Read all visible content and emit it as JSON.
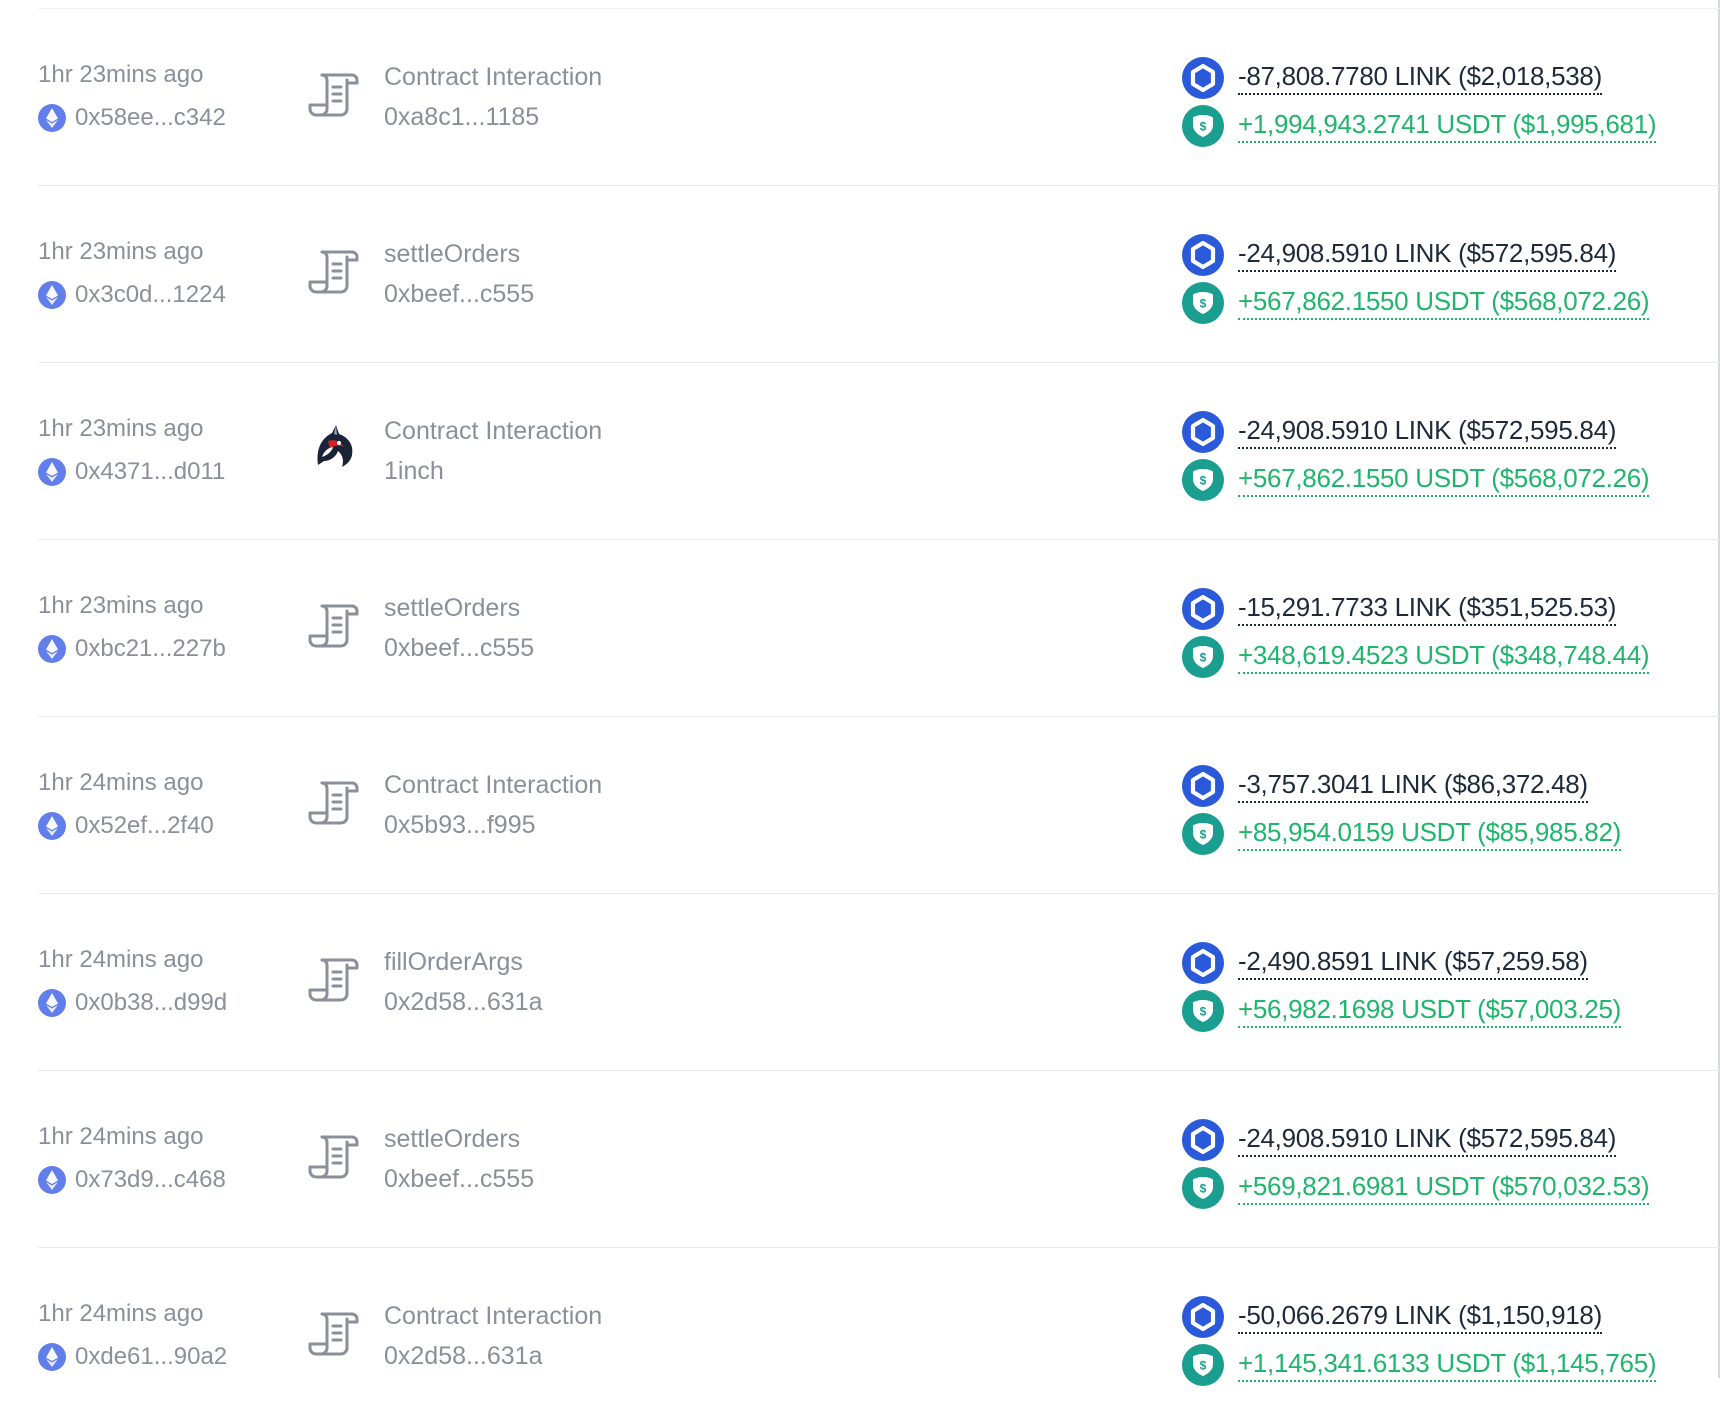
{
  "colors": {
    "muted_text": "#8a8f99",
    "negative_amount": "#1e2a3b",
    "positive_amount": "#1fb56b",
    "link_token": "#2a5ada",
    "usdt_token": "#1a9e8f",
    "eth_icon": "#627eea"
  },
  "icons": {
    "from_chain": "ethereum-icon",
    "method_default": "scroll-contract-icon",
    "method_1inch": "1inch-unicorn-icon",
    "token_out": "chainlink-icon",
    "token_in": "usdt-icon"
  },
  "transactions": [
    {
      "time": "1hr 23mins ago",
      "from": "0x58ee...c342",
      "method": "Contract Interaction",
      "contract": "0xa8c1...1185",
      "method_icon": "scroll",
      "out": "-87,808.7780 LINK ($2,018,538)",
      "in": "+1,994,943.2741 USDT ($1,995,681)"
    },
    {
      "time": "1hr 23mins ago",
      "from": "0x3c0d...1224",
      "method": "settleOrders",
      "contract": "0xbeef...c555",
      "method_icon": "scroll",
      "out": "-24,908.5910 LINK ($572,595.84)",
      "in": "+567,862.1550 USDT ($568,072.26)"
    },
    {
      "time": "1hr 23mins ago",
      "from": "0x4371...d011",
      "method": "Contract Interaction",
      "contract": "1inch",
      "method_icon": "1inch",
      "out": "-24,908.5910 LINK ($572,595.84)",
      "in": "+567,862.1550 USDT ($568,072.26)"
    },
    {
      "time": "1hr 23mins ago",
      "from": "0xbc21...227b",
      "method": "settleOrders",
      "contract": "0xbeef...c555",
      "method_icon": "scroll",
      "out": "-15,291.7733 LINK ($351,525.53)",
      "in": "+348,619.4523 USDT ($348,748.44)"
    },
    {
      "time": "1hr 24mins ago",
      "from": "0x52ef...2f40",
      "method": "Contract Interaction",
      "contract": "0x5b93...f995",
      "method_icon": "scroll",
      "out": "-3,757.3041 LINK ($86,372.48)",
      "in": "+85,954.0159 USDT ($85,985.82)"
    },
    {
      "time": "1hr 24mins ago",
      "from": "0x0b38...d99d",
      "method": "fillOrderArgs",
      "contract": "0x2d58...631a",
      "method_icon": "scroll",
      "out": "-2,490.8591 LINK ($57,259.58)",
      "in": "+56,982.1698 USDT ($57,003.25)"
    },
    {
      "time": "1hr 24mins ago",
      "from": "0x73d9...c468",
      "method": "settleOrders",
      "contract": "0xbeef...c555",
      "method_icon": "scroll",
      "out": "-24,908.5910 LINK ($572,595.84)",
      "in": "+569,821.6981 USDT ($570,032.53)"
    },
    {
      "time": "1hr 24mins ago",
      "from": "0xde61...90a2",
      "method": "Contract Interaction",
      "contract": "0x2d58...631a",
      "method_icon": "scroll",
      "out": "-50,066.2679 LINK ($1,150,918)",
      "in": "+1,145,341.6133 USDT ($1,145,765)"
    }
  ]
}
